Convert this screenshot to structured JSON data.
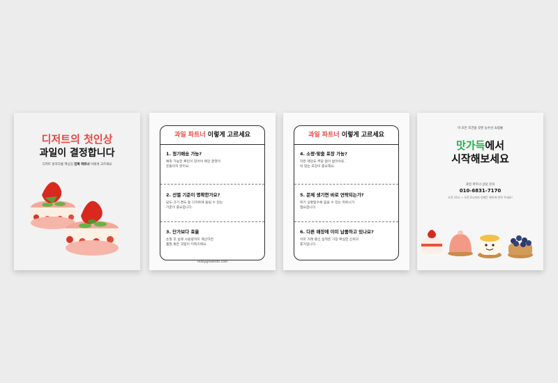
{
  "card1": {
    "title_line1": "디저트의 첫인상",
    "title_line2": "과일이 결정합니다",
    "subtitle_prefix": "디저트 원하다릉 핵심임 ",
    "subtitle_bold": "진짜 파트너",
    "subtitle_suffix": " 이렇게 고르세요"
  },
  "card2": {
    "title_accent": "과일 파트너",
    "title_rest": " 이렇게 고르세요",
    "items": [
      {
        "title": "1. 정기배송 가능?",
        "desc_line1": "예측 가능한 루틴이 있어야 매장 운영이",
        "desc_line2": "흔들리지 않아요."
      },
      {
        "title": "2. 선별 기준이 명확한가요?",
        "desc_line1": "당도·크기·경도 등 디저트에 올릴 수 있는",
        "desc_line2": "기준이 중요합니다."
      },
      {
        "title": "3. 단가보다 효율",
        "desc_line1": "손질 후 실제 사용량까지 계산하면",
        "desc_line2": "품질 좋은 과일이 이득이에요."
      }
    ],
    "website": "reallygreatsite.com"
  },
  "card3": {
    "title_accent": "과일 파트너",
    "title_rest": " 이렇게 고르세요",
    "items": [
      {
        "title": "4. 소량·맞춤 포장 가능?",
        "desc_line1": "작은 매장도 부담 없이 받아야죠.",
        "desc_line2": "딱 맞는 포장이 중요해요."
      },
      {
        "title": "5. 문제 생기면 바로 연락되는가?",
        "desc_line1": "위기 상황일수록 믿을 수 있는 파트너가",
        "desc_line2": "필요합니다."
      },
      {
        "title": "6. 다른 매장에 이미 납품하고 있나요?",
        "desc_line1": "이미 거래 중인 실적은 가장 확실한 신뢰의",
        "desc_line2": "증거입니다."
      }
    ]
  },
  "card4": {
    "tagline": "이 모든 조건을 갖춘 농수산 쇼핑몰",
    "brand_accent": "맛가득",
    "brand_rest": "에서",
    "brand_line2": "시작해보세요",
    "consult_label": "과일 파트너 상담 문의",
    "phone": "010-6831-7170",
    "hours": "오전 10시 ~ 오후 6시까지 언제든 편하게 연락 주세요!"
  },
  "colors": {
    "accent_red": "#e8473f",
    "accent_green": "#1fb24a",
    "background": "#ececec"
  }
}
